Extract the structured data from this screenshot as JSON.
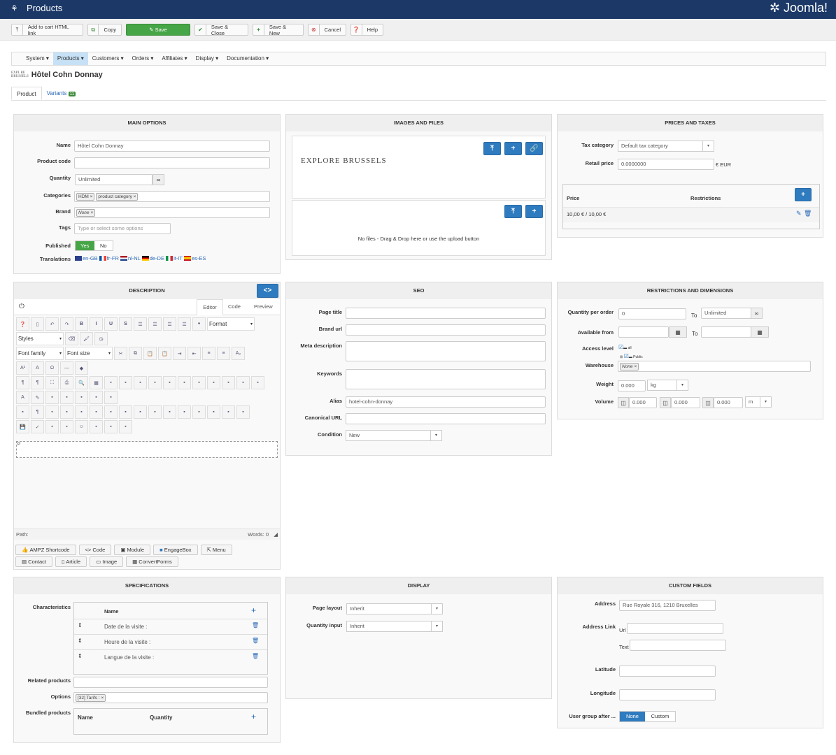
{
  "header": {
    "title": "Products",
    "brand": "Joomla!"
  },
  "toolbar": {
    "add_to_cart": "Add to cart HTML link",
    "copy": "Copy",
    "save": "Save",
    "save_close": "Save & Close",
    "save_new": "Save & New",
    "cancel": "Cancel",
    "help": "Help"
  },
  "nav": [
    "System ▾",
    "Products ▾",
    "Customers ▾",
    "Orders ▾",
    "Affiliates ▾",
    "Display ▾",
    "Documentation ▾"
  ],
  "page": {
    "title": "Hôtel Cohn Donnay",
    "logo_text": "EXPLORE BRUSSELS"
  },
  "tabs": {
    "product": "Product",
    "variants": "Variants",
    "variants_count": "11"
  },
  "main_options": {
    "title": "MAIN OPTIONS",
    "name_label": "Name",
    "name": "Hôtel Cohn Donnay",
    "code_label": "Product code",
    "qty_label": "Quantity",
    "qty": "Unlimited",
    "cat_label": "Categories",
    "cats": [
      "HDM",
      "product category"
    ],
    "brand_label": "Brand",
    "brand": "None",
    "tags_label": "Tags",
    "tags_placeholder": "Type or select some options",
    "published_label": "Published",
    "yes": "Yes",
    "no": "No",
    "translations_label": "Translations",
    "translations": [
      "en-GB",
      "fr-FR",
      "nl-NL",
      "de-DE",
      "it-IT",
      "es-ES"
    ]
  },
  "images": {
    "title": "IMAGES AND FILES",
    "no_files": "No files - Drag & Drop here or use the upload button"
  },
  "prices": {
    "title": "PRICES AND TAXES",
    "tax_label": "Tax category",
    "tax": "Default tax category",
    "retail_label": "Retail price",
    "retail": "0.0000000",
    "currency": "€ EUR",
    "col_price": "Price",
    "col_restr": "Restrictions",
    "row_price": "10,00 € / 10,00 €"
  },
  "description": {
    "title": "DESCRIPTION",
    "tab_editor": "Editor",
    "tab_code": "Code",
    "tab_preview": "Preview",
    "format": "Format",
    "styles": "Styles",
    "font_family": "Font family",
    "font_size": "Font size",
    "path": "Path:",
    "words": "Words: 0",
    "buttons": [
      "AMPZ Shortcode",
      "Code",
      "Module",
      "EngageBox",
      "Menu",
      "Contact",
      "Article",
      "Image",
      "ConvertForms"
    ]
  },
  "seo": {
    "title": "SEO",
    "page_title": "Page title",
    "brand_url": "Brand url",
    "meta": "Meta description",
    "keywords": "Keywords",
    "alias_label": "Alias",
    "alias": "hotel-cohn-donnay",
    "canonical": "Canonical URL",
    "condition_label": "Condition",
    "condition": "New"
  },
  "restrictions": {
    "title": "RESTRICTIONS AND DIMENSIONS",
    "qpo_label": "Quantity per order",
    "qpo_from": "0",
    "to": "To",
    "qpo_to": "Unlimited",
    "avail_label": "Available from",
    "access_label": "Access level",
    "access_all": "all",
    "access_public": "Public",
    "warehouse_label": "Warehouse",
    "warehouse": "None",
    "weight_label": "Weight",
    "weight": "0.000",
    "weight_unit": "kg",
    "volume_label": "Volume",
    "vol": [
      "0.000",
      "0.000",
      "0.000"
    ],
    "vol_unit": "m"
  },
  "specs": {
    "title": "SPECIFICATIONS",
    "char_label": "Characteristics",
    "col_name": "Name",
    "rows": [
      "Date de la visite :",
      "Heure de la visite :",
      "Langue de la visite :"
    ],
    "related_label": "Related products",
    "options_label": "Options",
    "option": "[32] Tarifs :",
    "bundled_label": "Bundled products",
    "b_name": "Name",
    "b_qty": "Quantity"
  },
  "display": {
    "title": "DISPLAY",
    "layout_label": "Page layout",
    "layout": "Inherit",
    "qi_label": "Quantity input",
    "qi": "Inherit"
  },
  "custom": {
    "title": "CUSTOM FIELDS",
    "address_label": "Address",
    "address": "Rue Royale 316, 1210 Bruxelles",
    "link_label": "Address Link",
    "url": "Url",
    "text": "Text",
    "lat": "Latitude",
    "lon": "Longitude",
    "ug_label": "User group after ...",
    "none": "None",
    "custom": "Custom"
  },
  "editor_rows": [
    [
      "help",
      "new",
      "undo",
      "redo",
      "|",
      "B",
      "I",
      "U",
      "S",
      "align-left",
      "align-center",
      "align-right",
      "justify",
      "blockquote",
      "#format"
    ],
    [
      "#styles",
      "eraser",
      "brush",
      "history"
    ],
    [
      "#font_family",
      "#font_size",
      "cut",
      "copy",
      "paste",
      "paste-word",
      "indent",
      "outdent",
      "ol",
      "ul",
      "sub"
    ],
    [
      "sup",
      "charmap",
      "omega",
      "hr",
      "shapes"
    ],
    [
      "ltr",
      "rtl",
      "fullscreen",
      "print",
      "find",
      "table",
      "del-row",
      "row",
      "cell",
      "col-before",
      "col-after",
      "del-col",
      "split",
      "merge",
      "border",
      "props",
      "frame"
    ],
    [
      "text-color",
      "highlight",
      "insert",
      "layer",
      "layer2",
      "box",
      "template"
    ],
    [
      "grid",
      "pilcrow",
      "pdf",
      "media",
      "font",
      "cite",
      "abbr",
      "acronym",
      "strike",
      "attr",
      "anchor",
      "link",
      "unlink",
      "chain",
      "image",
      "img2"
    ],
    [
      "save",
      "spell",
      "visual",
      "block",
      "emoji",
      "add",
      "remove",
      "widget"
    ]
  ],
  "colors": {
    "header": "#1b3867",
    "accent": "#2f7bbf",
    "green": "#46a546"
  }
}
